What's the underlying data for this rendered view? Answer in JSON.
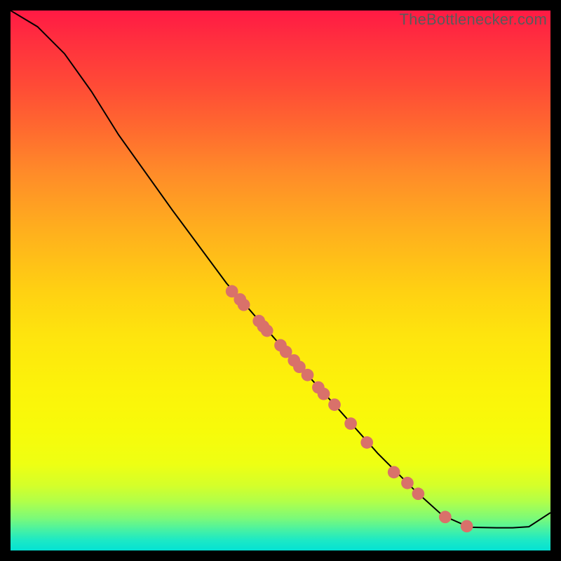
{
  "watermark": "TheBottlenecker.com",
  "chart_data": {
    "type": "line",
    "title": "",
    "xlabel": "",
    "ylabel": "",
    "xlim": [
      0,
      100
    ],
    "ylim": [
      0,
      100
    ],
    "note": "Unlabeled bottleneck curve on a red-to-green vertical gradient background. Curve descends from top-left, flattens near bottom-right, then upturns slightly at far right. Salmon markers sit along the mid-to-lower segment.",
    "curve": [
      {
        "x": 0,
        "y": 100
      },
      {
        "x": 5,
        "y": 97
      },
      {
        "x": 10,
        "y": 92
      },
      {
        "x": 15,
        "y": 85
      },
      {
        "x": 20,
        "y": 77
      },
      {
        "x": 30,
        "y": 63
      },
      {
        "x": 40,
        "y": 49.5
      },
      {
        "x": 50,
        "y": 38
      },
      {
        "x": 60,
        "y": 27
      },
      {
        "x": 68,
        "y": 18
      },
      {
        "x": 75,
        "y": 11
      },
      {
        "x": 80,
        "y": 6.5
      },
      {
        "x": 85,
        "y": 4.3
      },
      {
        "x": 90,
        "y": 4.2
      },
      {
        "x": 93,
        "y": 4.2
      },
      {
        "x": 96,
        "y": 4.4
      },
      {
        "x": 100,
        "y": 7
      }
    ],
    "markers": [
      {
        "x": 41,
        "y": 48
      },
      {
        "x": 42.5,
        "y": 46.5
      },
      {
        "x": 43.2,
        "y": 45.5
      },
      {
        "x": 46,
        "y": 42.5
      },
      {
        "x": 46.8,
        "y": 41.5
      },
      {
        "x": 47.5,
        "y": 40.7
      },
      {
        "x": 50,
        "y": 38
      },
      {
        "x": 51,
        "y": 36.8
      },
      {
        "x": 52.5,
        "y": 35.2
      },
      {
        "x": 53.5,
        "y": 34
      },
      {
        "x": 55,
        "y": 32.5
      },
      {
        "x": 57,
        "y": 30.2
      },
      {
        "x": 58,
        "y": 29
      },
      {
        "x": 60,
        "y": 27
      },
      {
        "x": 63,
        "y": 23.5
      },
      {
        "x": 66,
        "y": 20
      },
      {
        "x": 71,
        "y": 14.5
      },
      {
        "x": 73.5,
        "y": 12.5
      },
      {
        "x": 75.5,
        "y": 10.5
      },
      {
        "x": 80.5,
        "y": 6.2
      },
      {
        "x": 84.5,
        "y": 4.5
      }
    ],
    "marker_color": "#d9716a",
    "curve_color": "#000000"
  }
}
